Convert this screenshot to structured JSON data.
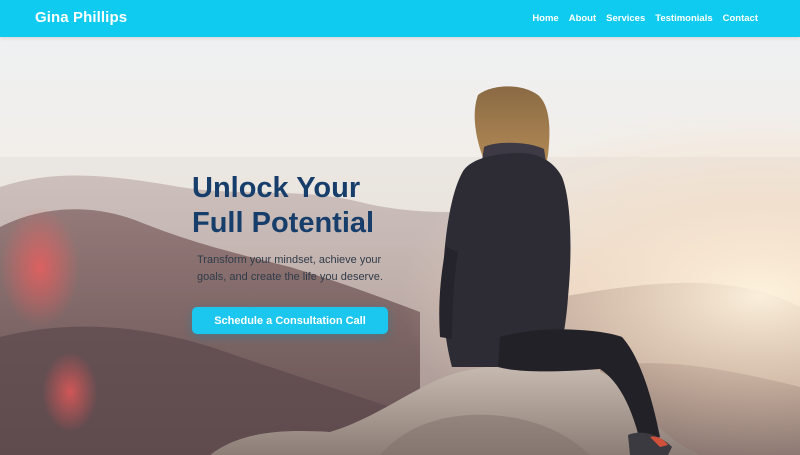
{
  "header": {
    "brand": "Gina Phillips",
    "nav": [
      {
        "label": "Home"
      },
      {
        "label": "About"
      },
      {
        "label": "Services"
      },
      {
        "label": "Testimonials"
      },
      {
        "label": "Contact"
      }
    ],
    "background_color": "#0fcbf0"
  },
  "hero": {
    "heading_line1": "Unlock Your",
    "heading_line2": "Full Potential",
    "subtext": "Transform your mindset, achieve your goals, and create the life you deserve.",
    "cta_label": "Schedule a Consultation Call",
    "heading_color": "#173d6a",
    "cta_color": "#1bc6ef"
  },
  "icons": {
    "background_image": "mountain-summit-woman-photo"
  }
}
